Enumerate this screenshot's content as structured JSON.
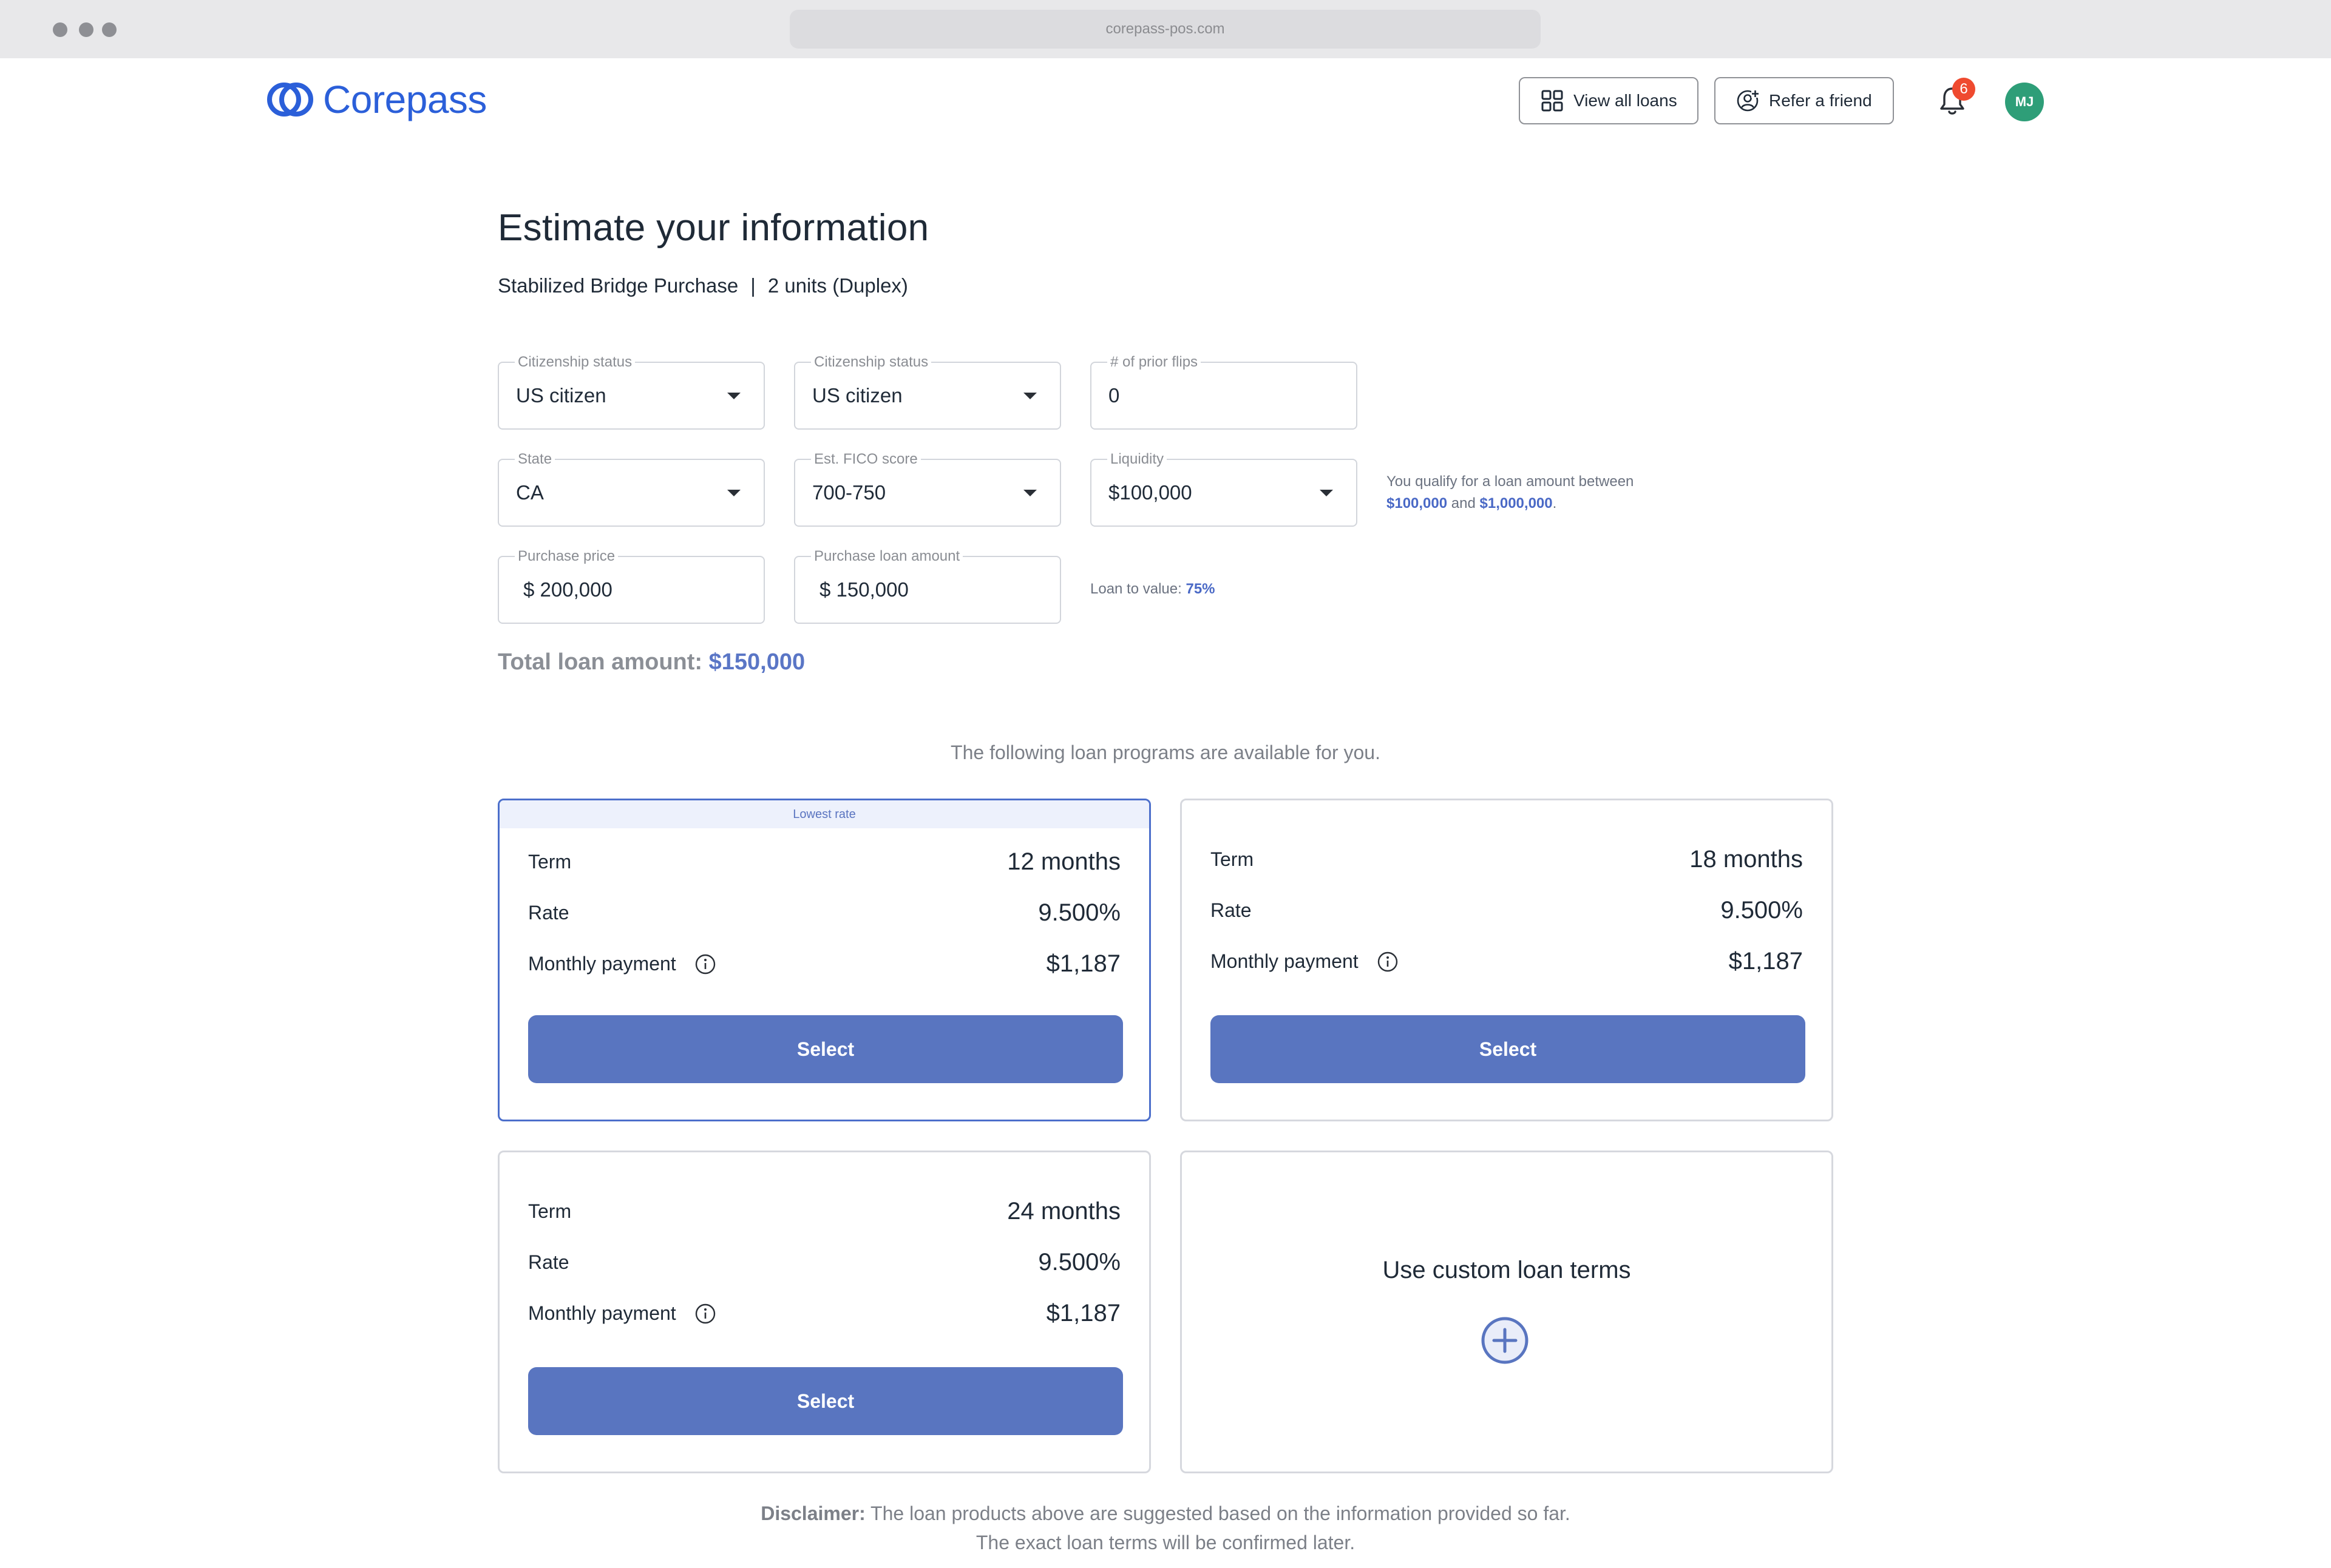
{
  "browser": {
    "url": "corepass-pos.com"
  },
  "header": {
    "logo_text": "Corepass",
    "view_all_loans": "View all loans",
    "refer_friend": "Refer a friend",
    "notification_count": "6",
    "avatar_initials": "MJ"
  },
  "page": {
    "title": "Estimate your information",
    "loan_type": "Stabilized Bridge Purchase",
    "separator": "|",
    "units": "2 units (Duplex)"
  },
  "form": {
    "citizenship_1": {
      "label": "Citizenship status",
      "value": "US citizen"
    },
    "citizenship_2": {
      "label": "Citizenship status",
      "value": "US citizen"
    },
    "prior_flips": {
      "label": "# of prior flips",
      "value": "0"
    },
    "state": {
      "label": "State",
      "value": "CA"
    },
    "fico": {
      "label": "Est. FICO score",
      "value": "700-750"
    },
    "liquidity": {
      "label": "Liquidity",
      "value": "$100,000"
    },
    "purchase_price": {
      "label": "Purchase price",
      "value": "$ 200,000"
    },
    "purchase_loan": {
      "label": "Purchase loan amount",
      "value": "$ 150,000"
    }
  },
  "qualify_note": {
    "prefix": "You qualify for a loan amount between",
    "min": "$100,000",
    "and": "and",
    "max": "$1,000,000",
    "suffix": "."
  },
  "ltv": {
    "label": "Loan to value:",
    "value": "75%"
  },
  "total": {
    "label": "Total loan amount:",
    "value": "$150,000"
  },
  "programs_intro": "The following loan programs are available for you.",
  "labels": {
    "term": "Term",
    "rate": "Rate",
    "monthly_payment": "Monthly payment",
    "select": "Select"
  },
  "programs": [
    {
      "ribbon": "Lowest rate",
      "term": "12 months",
      "rate": "9.500%",
      "payment": "$1,187"
    },
    {
      "term": "18 months",
      "rate": "9.500%",
      "payment": "$1,187"
    },
    {
      "term": "24 months",
      "rate": "9.500%",
      "payment": "$1,187"
    }
  ],
  "custom": {
    "title": "Use custom loan terms"
  },
  "disclaimer": {
    "bold": "Disclaimer:",
    "line1": "The loan products above are suggested based on the information provided so far.",
    "line2": "The exact loan terms will be confirmed later."
  },
  "colors": {
    "brand": "#2b5fd9",
    "primary_button": "#5975c0",
    "selected_border": "#4c6fcb",
    "badge": "#ef4a2f",
    "avatar": "#2e9e78"
  }
}
